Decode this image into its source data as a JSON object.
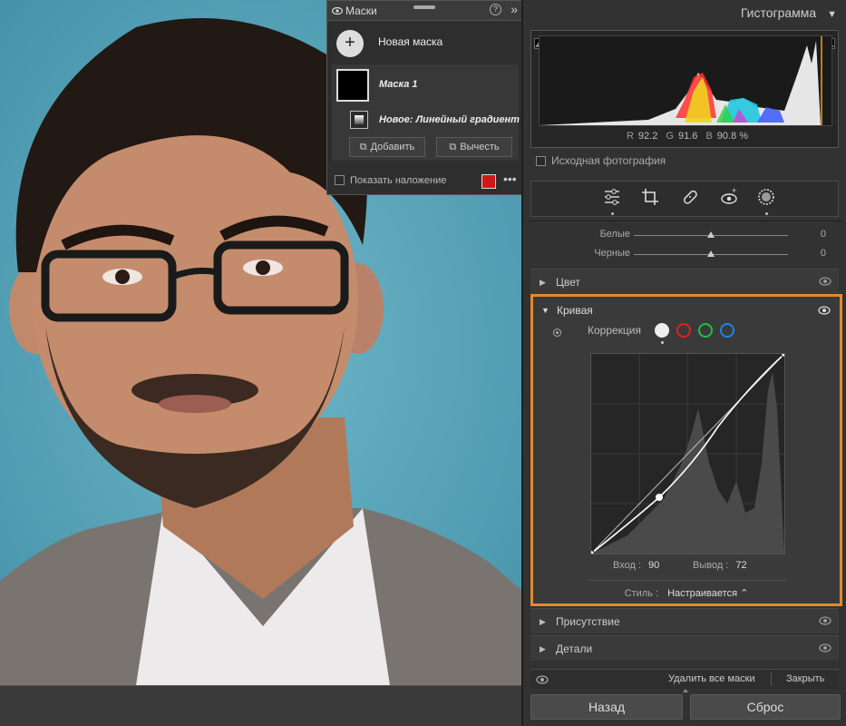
{
  "masks_panel": {
    "title": "Маски",
    "new_mask": "Новая маска",
    "mask_name": "Маска 1",
    "gradient_label": "Новое: Линейный градиент",
    "add_label": "Добавить",
    "subtract_label": "Вычесть",
    "overlay_label": "Показать наложение",
    "overlay_color": "#d01818"
  },
  "histogram": {
    "title": "Гистограмма",
    "r_label": "R",
    "r_value": "92.2",
    "g_label": "G",
    "g_value": "91.6",
    "b_label": "B",
    "b_value": "90.8",
    "unit": "%",
    "original_photo": "Исходная фотография"
  },
  "tools": [
    "sliders-icon",
    "crop-icon",
    "healing-icon",
    "red-eye-icon",
    "mask-icon"
  ],
  "sliders": [
    {
      "label": "Белые",
      "value": "0",
      "position": 0.5
    },
    {
      "label": "Черные",
      "value": "0",
      "position": 0.5
    }
  ],
  "sections": {
    "color": "Цвет",
    "curve": "Кривая",
    "presence": "Присутствие",
    "details": "Детали"
  },
  "curve": {
    "correction_label": "Коррекция",
    "input_label": "Вход :",
    "input_value": "90",
    "output_label": "Вывод :",
    "output_value": "72",
    "style_label": "Стиль :",
    "style_value": "Настраивается ⌃"
  },
  "footer": {
    "delete_all": "Удалить все маски",
    "close": "Закрыть",
    "back": "Назад",
    "reset": "Сброс"
  }
}
